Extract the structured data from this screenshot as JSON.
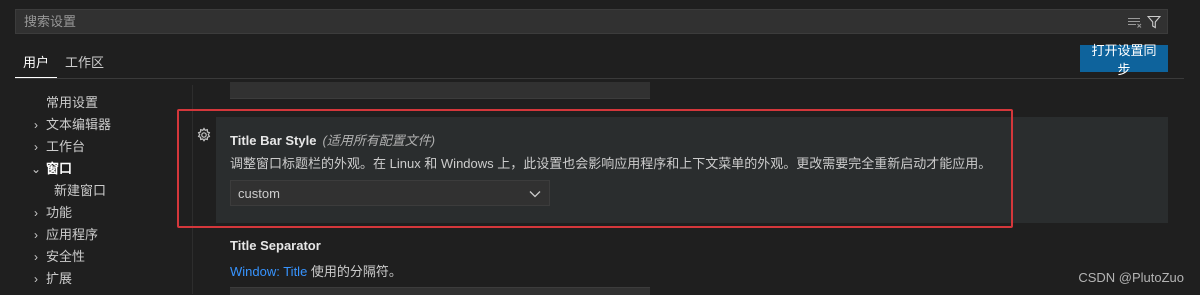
{
  "search": {
    "placeholder": "搜索设置"
  },
  "tabs": [
    {
      "label": "用户"
    },
    {
      "label": "工作区"
    }
  ],
  "sync_button": {
    "label": "打开设置同步"
  },
  "toc": [
    {
      "label": "常用设置"
    },
    {
      "label": "文本编辑器"
    },
    {
      "label": "工作台"
    },
    {
      "label": "窗口"
    },
    {
      "label": "新建窗口"
    },
    {
      "label": "功能"
    },
    {
      "label": "应用程序"
    },
    {
      "label": "安全性"
    },
    {
      "label": "扩展"
    }
  ],
  "setting_title_bar": {
    "title": "Title Bar Style",
    "scope": "(适用所有配置文件)",
    "description": "调整窗口标题栏的外观。在 Linux 和 Windows 上，此设置也会影响应用程序和上下文菜单的外观。更改需要完全重新启动才能应用。",
    "value": "custom"
  },
  "setting_title_separator": {
    "title": "Title Separator",
    "link_text": "Window: Title",
    "description_suffix": " 使用的分隔符。"
  },
  "watermark": "CSDN @PlutoZuo",
  "colors": {
    "accent": "#0e639c",
    "focus_ring": "#d4373b",
    "link": "#3794ff"
  }
}
